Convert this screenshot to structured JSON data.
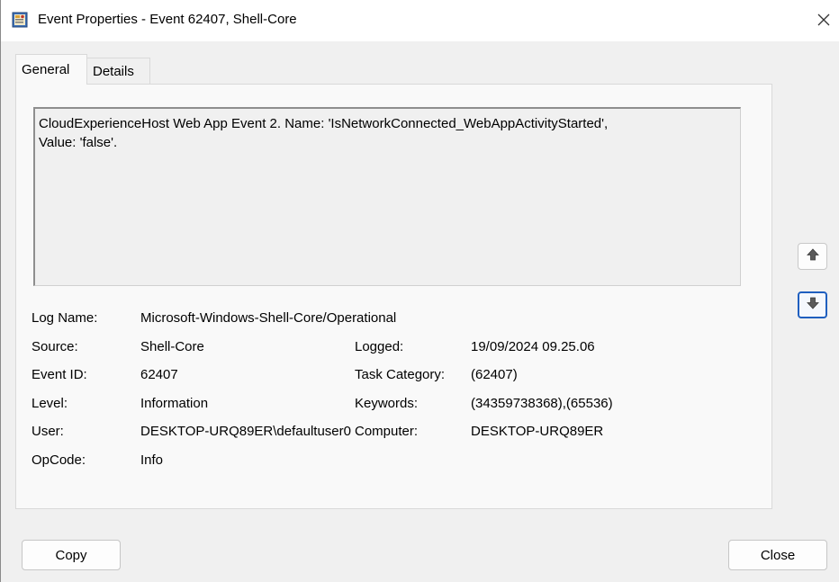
{
  "window": {
    "title": "Event Properties - Event 62407, Shell-Core",
    "app_icon": "event-viewer-icon",
    "close_icon": "close-icon"
  },
  "tabs": [
    {
      "label": "General",
      "selected": true
    },
    {
      "label": "Details",
      "selected": false
    }
  ],
  "description": "CloudExperienceHost Web App Event 2. Name: 'IsNetworkConnected_WebAppActivityStarted',\nValue: 'false'.",
  "fields": {
    "log_name": {
      "label": "Log Name:",
      "value": "Microsoft-Windows-Shell-Core/Operational"
    },
    "source": {
      "label": "Source:",
      "value": "Shell-Core"
    },
    "logged": {
      "label": "Logged:",
      "value": "19/09/2024 09.25.06"
    },
    "event_id": {
      "label": "Event ID:",
      "value": "62407"
    },
    "task_category": {
      "label": "Task Category:",
      "value": "(62407)"
    },
    "level": {
      "label": "Level:",
      "value": "Information"
    },
    "keywords": {
      "label": "Keywords:",
      "value": "(34359738368),(65536)"
    },
    "user": {
      "label": "User:",
      "value": "DESKTOP-URQ89ER\\defaultuser0"
    },
    "computer": {
      "label": "Computer:",
      "value": "DESKTOP-URQ89ER"
    },
    "opcode": {
      "label": "OpCode:",
      "value": "Info"
    }
  },
  "nav": {
    "up_icon": "arrow-up-icon",
    "down_icon": "arrow-down-icon"
  },
  "buttons": {
    "copy": "Copy",
    "close": "Close"
  }
}
